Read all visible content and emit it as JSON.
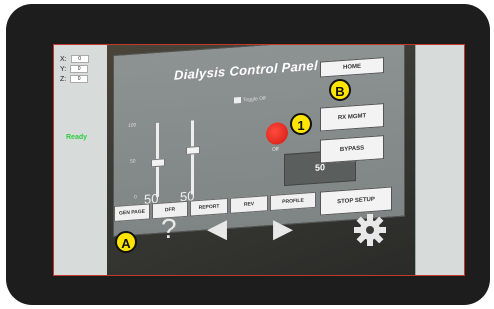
{
  "sidebar": {
    "coords": [
      {
        "axis": "X:",
        "value": "0"
      },
      {
        "axis": "Y:",
        "value": "0"
      },
      {
        "axis": "Z:",
        "value": "0"
      }
    ],
    "status": "Ready",
    "status_color": "#2ecc40"
  },
  "panel": {
    "title": "Dialysis Control Panel",
    "toggle_label": "Toggle Off",
    "slider_values": [
      "50",
      "50"
    ],
    "slider_scale": [
      "100",
      "50",
      "0"
    ],
    "indicator_label": "Off",
    "indicator_color": "#e02a20",
    "readout_value": "50",
    "tabs": [
      "GEN PAGE",
      "DFR",
      "REPORT",
      "REV",
      "PROFILE"
    ],
    "side_buttons": [
      "HOME",
      "RX MGMT",
      "BYPASS",
      "STOP SETUP"
    ]
  },
  "nav_icons": [
    "question-icon",
    "arrow-left-icon",
    "arrow-right-icon",
    "gear-icon"
  ],
  "callouts": {
    "one": "1",
    "a": "A",
    "b": "B",
    "color": "#ffe500"
  }
}
